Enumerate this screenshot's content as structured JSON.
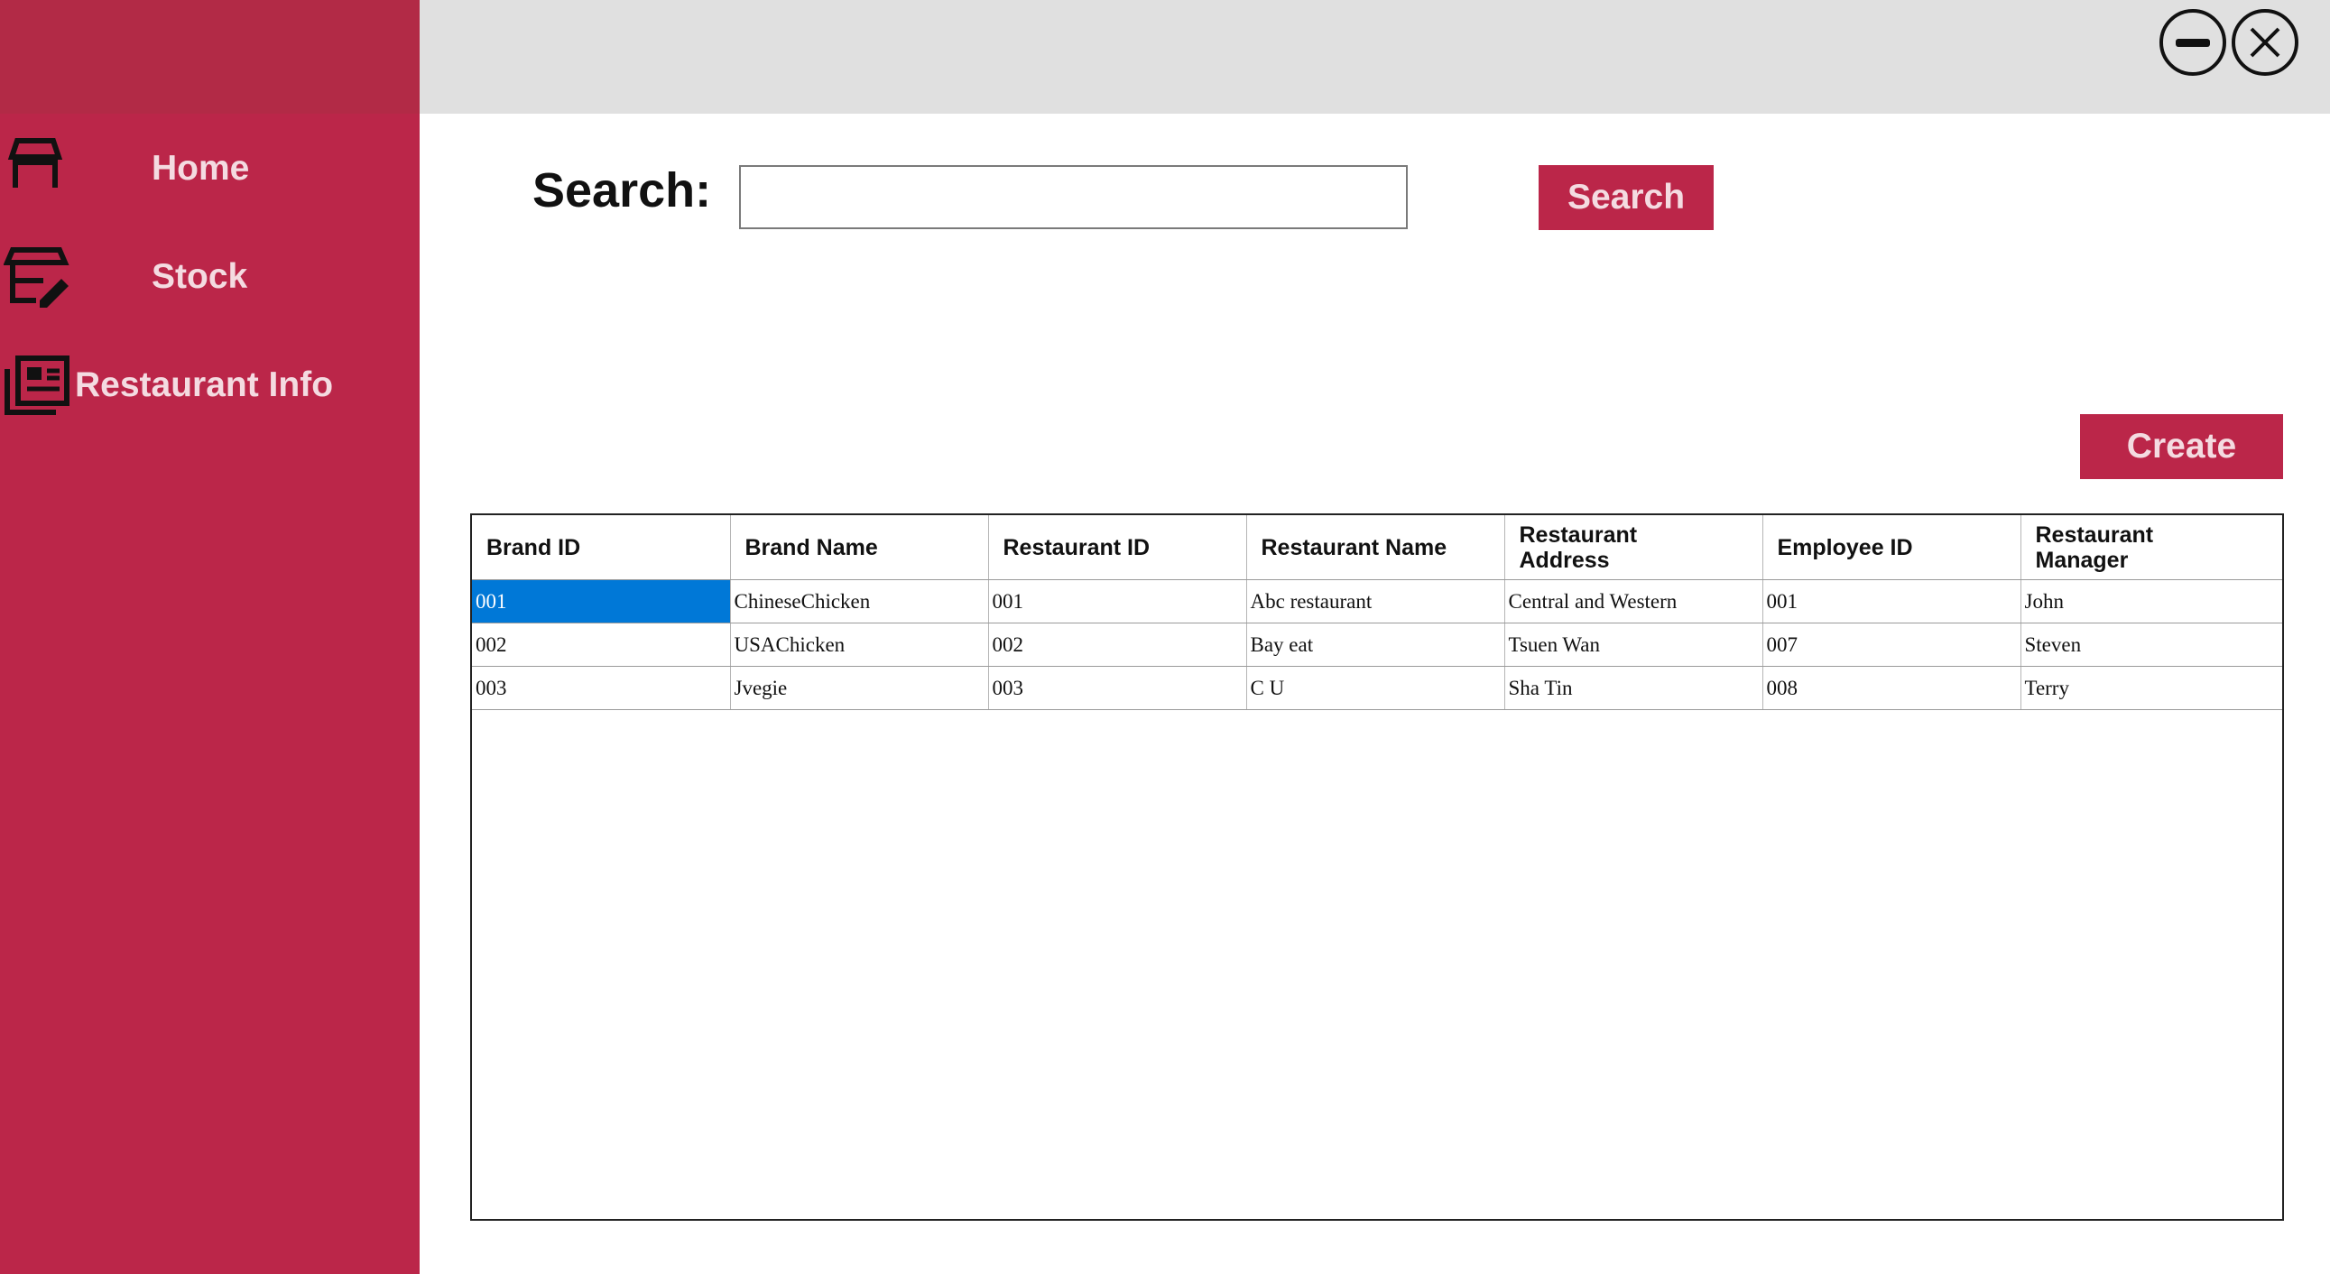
{
  "sidebar": {
    "items": [
      {
        "label": "Home",
        "icon": "store-icon"
      },
      {
        "label": "Stock",
        "icon": "stock-edit-icon"
      },
      {
        "label": "Restaurant Info",
        "icon": "info-list-icon"
      }
    ]
  },
  "window": {
    "minimize_icon": "minimize-icon",
    "close_icon": "close-icon"
  },
  "search": {
    "label": "Search:",
    "value": "",
    "placeholder": "",
    "button_label": "Search"
  },
  "create_label": "Create",
  "colors": {
    "accent": "#bb2649",
    "accent_text": "#f4dbe1",
    "topbar": "#e0e0e0",
    "selection": "#0078d7"
  },
  "table": {
    "headers": [
      "Brand ID",
      "Brand Name",
      "Restaurant ID",
      "Restaurant Name",
      "Restaurant Address",
      "Employee ID",
      "Restaurant Manager"
    ],
    "rows": [
      [
        "001",
        "ChineseChicken",
        "001",
        "Abc restaurant",
        "Central and Western",
        "001",
        "John"
      ],
      [
        "002",
        "USAChicken",
        "002",
        "Bay eat",
        "Tsuen Wan",
        "007",
        "Steven"
      ],
      [
        "003",
        "Jvegie",
        "003",
        "C U",
        "Sha Tin",
        "008",
        "Terry"
      ]
    ],
    "selected_cell": "0.0"
  }
}
